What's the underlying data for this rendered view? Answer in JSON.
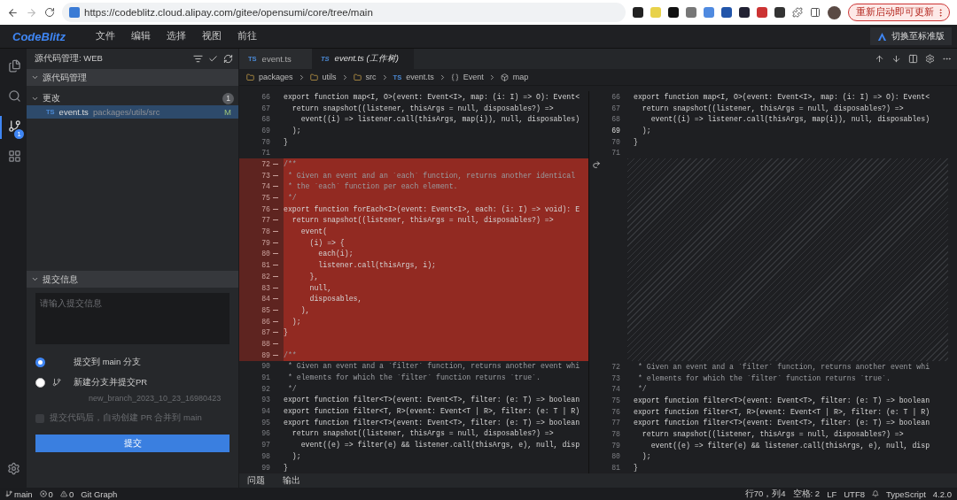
{
  "browser": {
    "url": "https://codeblitz.cloud.alipay.com/gitee/opensumi/core/tree/main",
    "update_button": "重新启动即可更新"
  },
  "menubar": {
    "logo": "CodeBlitz",
    "menus": [
      "文件",
      "编辑",
      "选择",
      "视图",
      "前往"
    ],
    "switch_button": "切换至标准版"
  },
  "activity_bar": [
    {
      "kind": "files",
      "selected": false
    },
    {
      "kind": "search",
      "selected": false
    },
    {
      "kind": "scm",
      "selected": true,
      "badge": "1"
    },
    {
      "kind": "extensions",
      "selected": false
    }
  ],
  "sidebar": {
    "title": "源代码管理: WEB",
    "section": {
      "title": "源代码管理",
      "expanded": true
    },
    "changes": {
      "title": "更改",
      "expanded": true,
      "count": "1",
      "files": [
        {
          "type_label": "TS",
          "name": "event.ts",
          "path": "packages/utils/src",
          "status": "M",
          "selected": true
        }
      ]
    },
    "commit": {
      "title": "提交信息",
      "expanded": true,
      "placeholder": "请输入提交信息",
      "options": [
        {
          "kind": "direct",
          "label": "提交到 main 分支",
          "selected": true
        },
        {
          "kind": "branch",
          "label": "新建分支并提交PR",
          "selected": false,
          "branch_name": "new_branch_2023_10_23_16980423"
        }
      ],
      "auto_pr": {
        "label": "提交代码后，自动创建 PR 合并到 main",
        "checked": false,
        "disabled": true
      },
      "submit": "提交"
    }
  },
  "editor": {
    "tabs": [
      {
        "type_label": "TS",
        "label": "event.ts",
        "selected": false
      },
      {
        "type_label": "TS",
        "label": "event.ts (工作树)",
        "selected": true
      }
    ],
    "breadcrumbs": [
      {
        "kind": "folder",
        "label": "packages"
      },
      {
        "kind": "folder",
        "label": "utils"
      },
      {
        "kind": "folder",
        "label": "src"
      },
      {
        "kind": "file",
        "type_label": "TS",
        "label": "event.ts"
      },
      {
        "kind": "namespace",
        "label": "Event"
      },
      {
        "kind": "function",
        "label": "map"
      }
    ],
    "left_lines": [
      {
        "number": "66",
        "kind": "code",
        "removed": false,
        "text": "export function map<I, O>(event: Event<I>, map: (i: I) => O): Event<"
      },
      {
        "number": "67",
        "kind": "code",
        "removed": false,
        "text": "  return snapshot((listener, thisArgs = null, disposables?) =>"
      },
      {
        "number": "68",
        "kind": "code",
        "removed": false,
        "text": "    event((i) => listener.call(thisArgs, map(i)), null, disposables)"
      },
      {
        "number": "69",
        "kind": "code",
        "removed": false,
        "text": "  );"
      },
      {
        "number": "70",
        "kind": "code",
        "removed": false,
        "text": "}"
      },
      {
        "number": "71",
        "kind": "blank",
        "removed": false
      },
      {
        "number": "72",
        "kind": "comment",
        "removed": true,
        "text": "/**"
      },
      {
        "number": "73",
        "kind": "comment",
        "removed": true,
        "text": " * Given an event and an `each` function, returns another identical"
      },
      {
        "number": "74",
        "kind": "comment",
        "removed": true,
        "text": " * the `each` function per each element."
      },
      {
        "number": "75",
        "kind": "comment",
        "removed": true,
        "text": " */"
      },
      {
        "number": "76",
        "kind": "code",
        "removed": true,
        "text": "export function forEach<I>(event: Event<I>, each: (i: I) => void): E"
      },
      {
        "number": "77",
        "kind": "code",
        "removed": true,
        "text": "  return snapshot((listener, thisArgs = null, disposables?) =>"
      },
      {
        "number": "78",
        "kind": "code",
        "removed": true,
        "text": "    event("
      },
      {
        "number": "79",
        "kind": "code",
        "removed": true,
        "text": "      (i) => {"
      },
      {
        "number": "80",
        "kind": "code",
        "removed": true,
        "text": "        each(i);"
      },
      {
        "number": "81",
        "kind": "code",
        "removed": true,
        "text": "        listener.call(thisArgs, i);"
      },
      {
        "number": "82",
        "kind": "code",
        "removed": true,
        "text": "      },"
      },
      {
        "number": "83",
        "kind": "code",
        "removed": true,
        "text": "      null,"
      },
      {
        "number": "84",
        "kind": "code",
        "removed": true,
        "text": "      disposables,"
      },
      {
        "number": "85",
        "kind": "code",
        "removed": true,
        "text": "    ),"
      },
      {
        "number": "86",
        "kind": "code",
        "removed": true,
        "text": "  );"
      },
      {
        "number": "87",
        "kind": "code",
        "removed": true,
        "text": "}"
      },
      {
        "number": "88",
        "kind": "blank",
        "removed": true
      },
      {
        "number": "89",
        "kind": "comment",
        "removed": true,
        "text": "/**"
      },
      {
        "number": "90",
        "kind": "comment",
        "removed": false,
        "text": " * Given an event and a `filter` function, returns another event whi"
      },
      {
        "number": "91",
        "kind": "comment",
        "removed": false,
        "text": " * elements for which the `filter` function returns `true`."
      },
      {
        "number": "92",
        "kind": "comment",
        "removed": false,
        "text": " */"
      },
      {
        "number": "93",
        "kind": "code",
        "removed": false,
        "text": "export function filter<T>(event: Event<T>, filter: (e: T) => boolean"
      },
      {
        "number": "94",
        "kind": "code",
        "removed": false,
        "text": "export function filter<T, R>(event: Event<T | R>, filter: (e: T | R)"
      },
      {
        "number": "95",
        "kind": "code",
        "removed": false,
        "text": "export function filter<T>(event: Event<T>, filter: (e: T) => boolean"
      },
      {
        "number": "96",
        "kind": "code",
        "removed": false,
        "text": "  return snapshot((listener, thisArgs = null, disposables?) =>"
      },
      {
        "number": "97",
        "kind": "code",
        "removed": false,
        "text": "    event((e) => filter(e) && listener.call(thisArgs, e), null, disp"
      },
      {
        "number": "98",
        "kind": "code",
        "removed": false,
        "text": "  );"
      },
      {
        "number": "99",
        "kind": "code",
        "removed": false,
        "text": "}"
      }
    ],
    "right_lines": [
      {
        "kind": "code",
        "number": "66",
        "current": false,
        "text": "export function map<I, O>(event: Event<I>, map: (i: I) => O): Event<"
      },
      {
        "kind": "code",
        "number": "67",
        "current": false,
        "text": "  return snapshot((listener, thisArgs = null, disposables?) =>"
      },
      {
        "kind": "code",
        "number": "68",
        "current": false,
        "text": "    event((i) => listener.call(thisArgs, map(i)), null, disposables)"
      },
      {
        "kind": "code",
        "number": "69",
        "current": true,
        "text": "  );"
      },
      {
        "kind": "code",
        "number": "70",
        "current": false,
        "text": "}"
      },
      {
        "kind": "blank",
        "number": "71",
        "current": false
      },
      {
        "kind": "gap"
      },
      {
        "kind": "comment",
        "number": "72",
        "current": false,
        "text": " * Given an event and a `filter` function, returns another event whi"
      },
      {
        "kind": "comment",
        "number": "73",
        "current": false,
        "text": " * elements for which the `filter` function returns `true`."
      },
      {
        "kind": "comment",
        "number": "74",
        "current": false,
        "text": " */"
      },
      {
        "kind": "code",
        "number": "75",
        "current": false,
        "text": "export function filter<T>(event: Event<T>, filter: (e: T) => boolean"
      },
      {
        "kind": "code",
        "number": "76",
        "current": false,
        "text": "export function filter<T, R>(event: Event<T | R>, filter: (e: T | R)"
      },
      {
        "kind": "code",
        "number": "77",
        "current": false,
        "text": "export function filter<T>(event: Event<T>, filter: (e: T) => boolean"
      },
      {
        "kind": "code",
        "number": "78",
        "current": false,
        "text": "  return snapshot((listener, thisArgs = null, disposables?) =>"
      },
      {
        "kind": "code",
        "number": "79",
        "current": false,
        "text": "    event((e) => filter(e) && listener.call(thisArgs, e), null, disp"
      },
      {
        "kind": "code",
        "number": "80",
        "current": false,
        "text": "  );"
      },
      {
        "kind": "code",
        "number": "81",
        "current": false,
        "text": "}"
      }
    ]
  },
  "panel_tabs": [
    "问题",
    "输出"
  ],
  "status_bar": {
    "branch": "main",
    "errors": "0",
    "warnings": "0",
    "git_graph": "Git Graph",
    "position": "行70，列4",
    "indent": "空格: 2",
    "eol": "LF",
    "encoding": "UTF8",
    "language": "TypeScript",
    "version": "4.2.0"
  }
}
